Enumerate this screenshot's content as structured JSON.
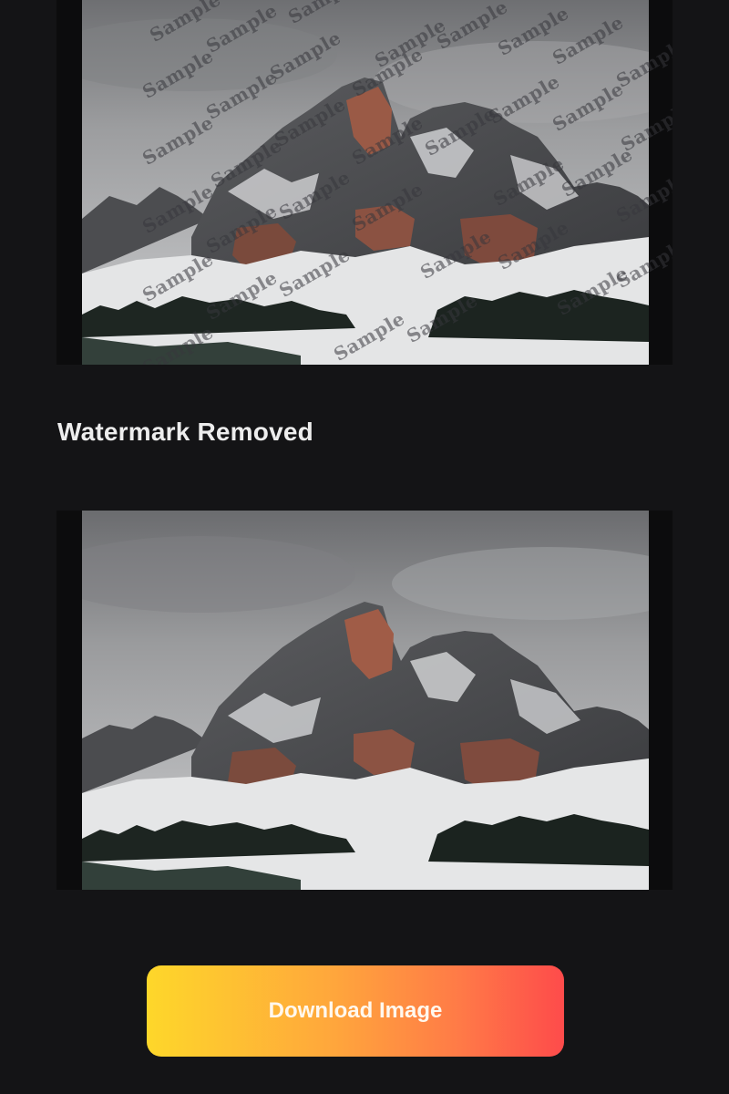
{
  "watermark": {
    "text": "Sample",
    "color": "#3a3a40"
  },
  "result": {
    "title": "Watermark Removed"
  },
  "actions": {
    "download_label": "Download Image"
  },
  "theme": {
    "background": "#141416",
    "button_gradient": [
      "#fed72a",
      "#ffa63c",
      "#ff7a47",
      "#fe4b4b"
    ]
  },
  "images": {
    "original": {
      "icon": "mountain-photo",
      "has_watermark": true
    },
    "cleaned": {
      "icon": "mountain-photo",
      "has_watermark": false
    }
  }
}
